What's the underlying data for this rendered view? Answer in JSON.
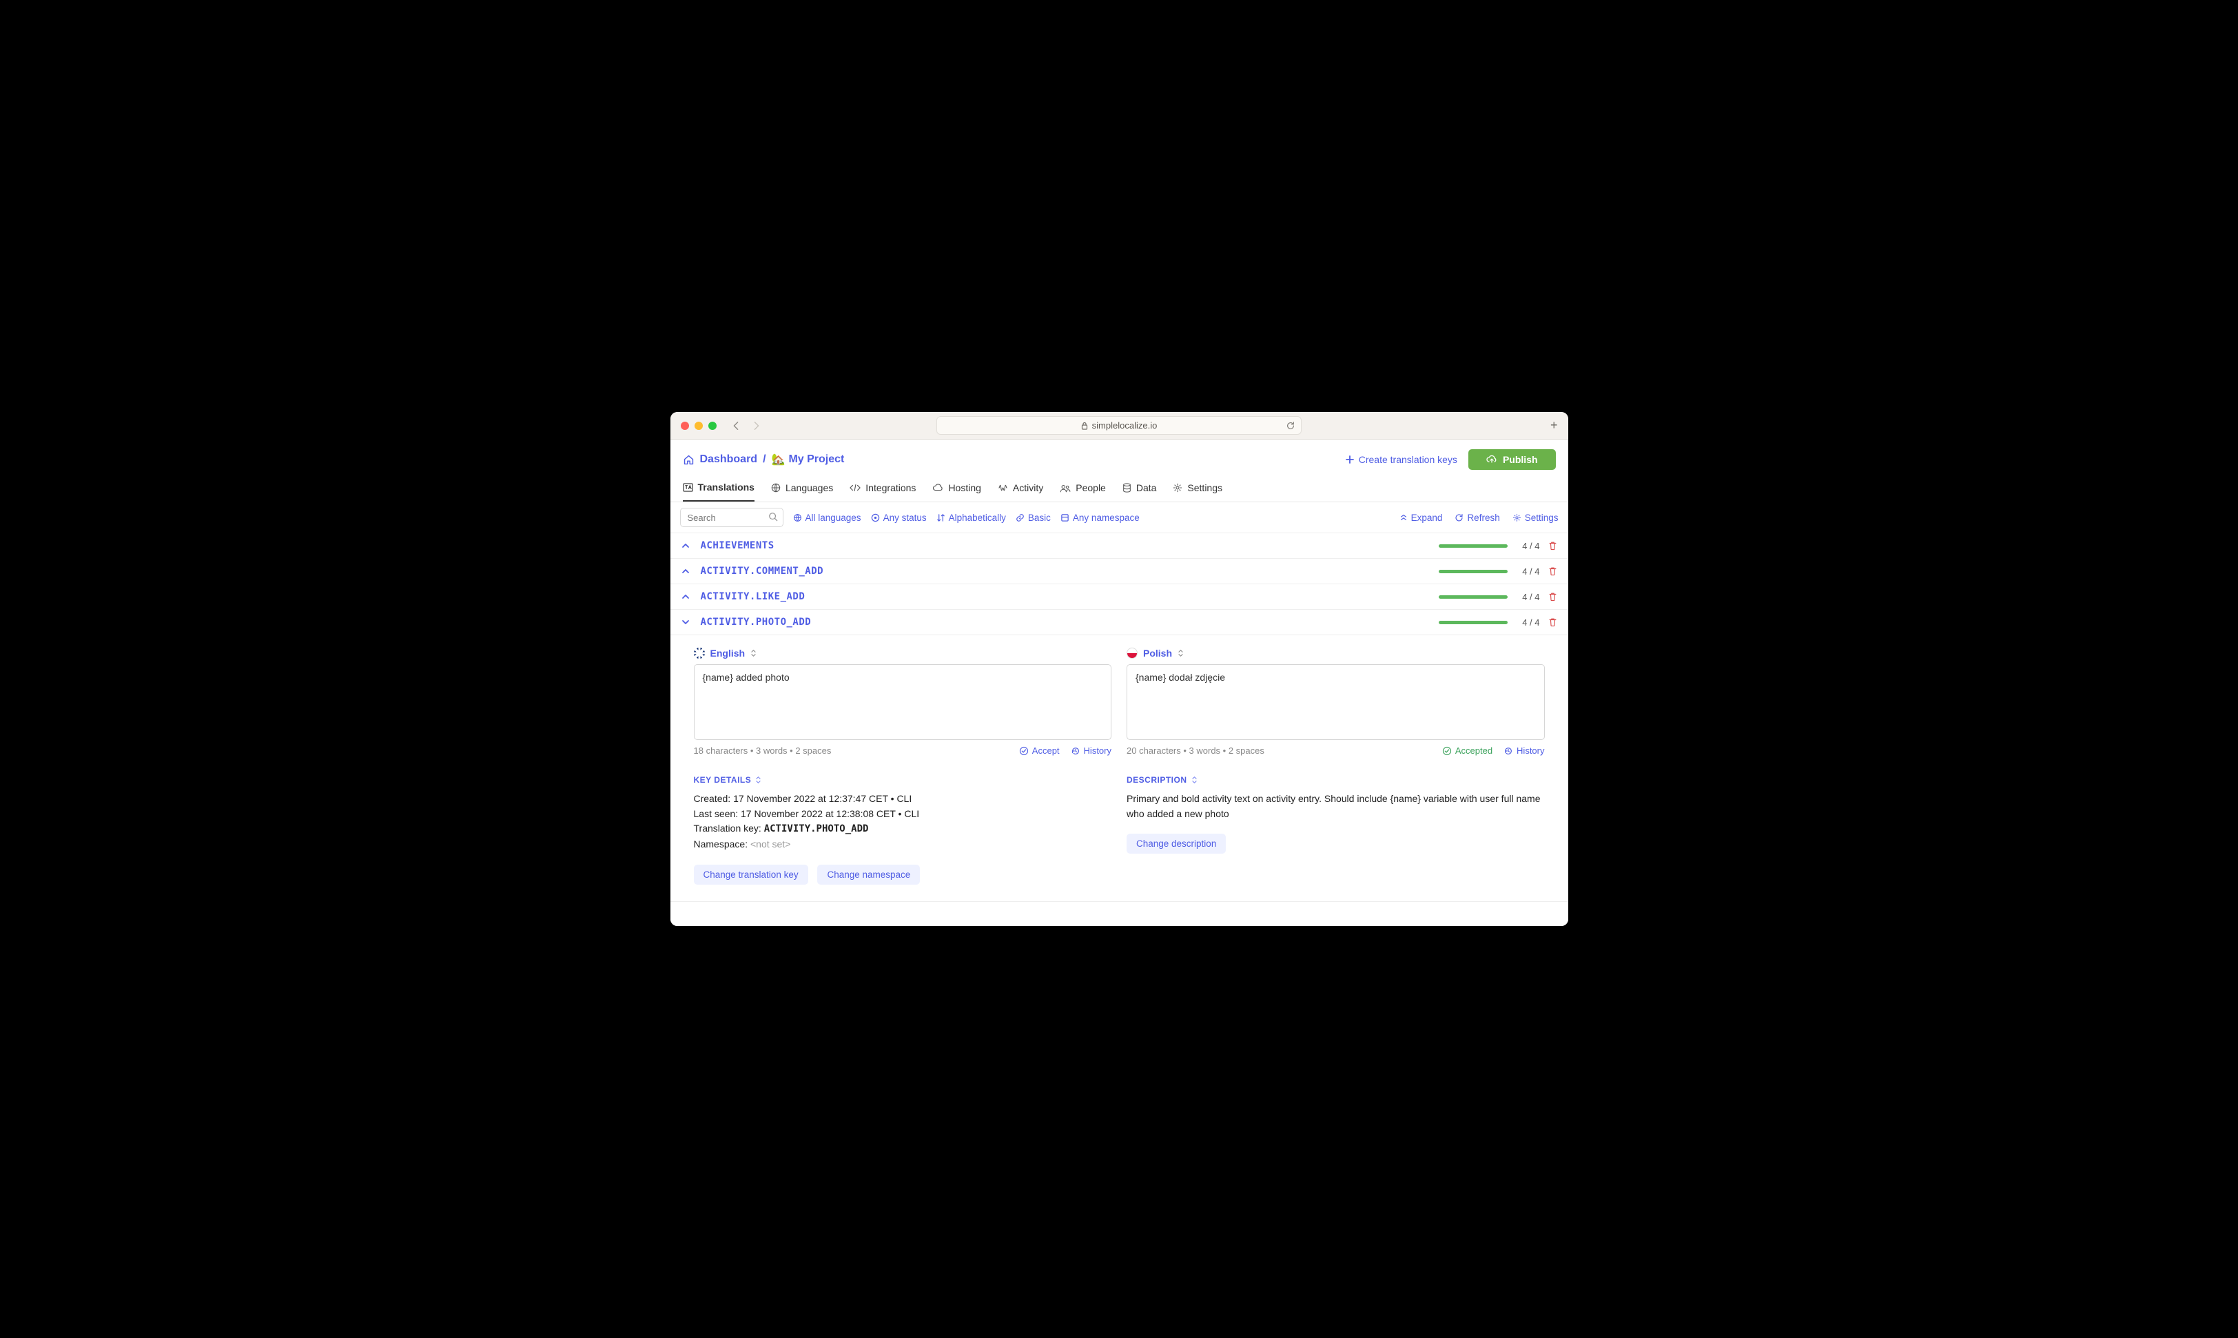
{
  "browser": {
    "url": "simplelocalize.io"
  },
  "breadcrumb": {
    "dashboard": "Dashboard",
    "sep": "/",
    "project_emoji": "🏡",
    "project": "My Project"
  },
  "header": {
    "create_keys": "Create translation keys",
    "publish": "Publish"
  },
  "tabs": [
    {
      "label": "Translations"
    },
    {
      "label": "Languages"
    },
    {
      "label": "Integrations"
    },
    {
      "label": "Hosting"
    },
    {
      "label": "Activity"
    },
    {
      "label": "People"
    },
    {
      "label": "Data"
    },
    {
      "label": "Settings"
    }
  ],
  "filters": {
    "search_placeholder": "Search",
    "all_languages": "All languages",
    "any_status": "Any status",
    "alpha": "Alphabetically",
    "basic": "Basic",
    "any_namespace": "Any namespace",
    "expand": "Expand",
    "refresh": "Refresh",
    "settings": "Settings"
  },
  "keys": [
    {
      "name": "ACHIEVEMENTS",
      "count": "4 / 4",
      "expanded": false
    },
    {
      "name": "ACTIVITY.COMMENT_ADD",
      "count": "4 / 4",
      "expanded": false
    },
    {
      "name": "ACTIVITY.LIKE_ADD",
      "count": "4 / 4",
      "expanded": false
    },
    {
      "name": "ACTIVITY.PHOTO_ADD",
      "count": "4 / 4",
      "expanded": true
    }
  ],
  "detail": {
    "english": {
      "name": "English",
      "value": "{name} added photo",
      "stats": "18 characters  •  3 words  •  2 spaces",
      "accept": "Accept",
      "history": "History"
    },
    "polish": {
      "name": "Polish",
      "value": "{name} dodał zdjęcie",
      "stats": "20 characters  •  3 words  •  2 spaces",
      "accepted": "Accepted",
      "history": "History"
    },
    "key_details": {
      "title": "KEY DETAILS",
      "created_label": "Created: ",
      "created": "17 November 2022 at 12:37:47 CET  •  CLI",
      "seen_label": "Last seen: ",
      "seen": "17 November 2022 at 12:38:08 CET  •  CLI",
      "tk_label": "Translation key: ",
      "tk": "ACTIVITY.PHOTO_ADD",
      "ns_label": "Namespace: ",
      "ns": "<not set>",
      "change_key": "Change translation key",
      "change_ns": "Change namespace"
    },
    "description": {
      "title": "DESCRIPTION",
      "text": "Primary and bold activity text on activity entry. Should include {name} variable with user full name who added a new photo",
      "change": "Change description"
    }
  }
}
